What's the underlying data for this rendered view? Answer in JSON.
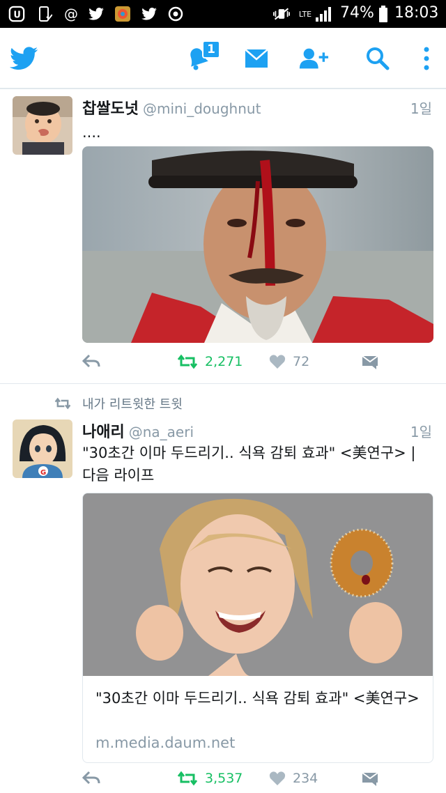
{
  "status_bar": {
    "battery": "74%",
    "time": "18:03",
    "network": "LTE"
  },
  "app_bar": {
    "notification_count": "1",
    "accent": "#1da1f2"
  },
  "tweets": [
    {
      "display_name": "찹쌀도넛",
      "handle": "@mini_doughnut",
      "time": "1일",
      "text": "....",
      "retweets": "2,271",
      "likes": "72"
    },
    {
      "retweet_context": "내가 리트윗한 트윗",
      "display_name": "나애리",
      "handle": "@na_aeri",
      "time": "1일",
      "text": "\"30초간 이마 두드리기.. 식욕 감퇴 효과\" <美연구> | 다음 라이프",
      "card_title": "\"30초간 이마 두드리기.. 식욕 감퇴 효과\" <美연구>",
      "card_url": "m.media.daum.net",
      "retweets": "3,537",
      "likes": "234"
    }
  ],
  "colors": {
    "retweet_green": "#17bf63",
    "muted": "#8899a6",
    "divider": "#e1e8ed"
  }
}
